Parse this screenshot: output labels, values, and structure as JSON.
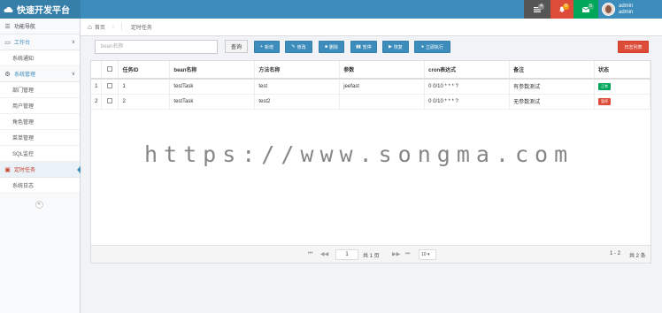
{
  "header": {
    "brand": "快速开发平台",
    "badges": [
      {
        "icon": "list-icon",
        "count": "4",
        "color": "#888888"
      },
      {
        "icon": "bell-icon",
        "count": "8",
        "color": "#f39c12"
      },
      {
        "icon": "envelope-icon",
        "count": "5",
        "color": "#00a65a"
      }
    ],
    "user": {
      "name": "admin",
      "role": "admin"
    }
  },
  "sidebar": {
    "items": [
      {
        "label": "功能导航",
        "type": "item",
        "icon": "navigation-icon"
      },
      {
        "label": "工作台",
        "type": "group",
        "icon": "monitor-icon"
      },
      {
        "label": "系统通知",
        "type": "sub"
      },
      {
        "label": "系统管理",
        "type": "group",
        "icon": "gear-icon"
      },
      {
        "label": "部门管理",
        "type": "sub"
      },
      {
        "label": "用户管理",
        "type": "sub"
      },
      {
        "label": "角色管理",
        "type": "sub"
      },
      {
        "label": "菜单管理",
        "type": "sub"
      },
      {
        "label": "SQL监控",
        "type": "sub"
      },
      {
        "label": "定时任务",
        "type": "active",
        "icon": "task-icon"
      },
      {
        "label": "系统日志",
        "type": "sub"
      }
    ]
  },
  "breadcrumb": {
    "home": "首页",
    "current": "定时任务"
  },
  "toolbar": {
    "search_placeholder": "bean名称",
    "query": "查询",
    "buttons": [
      {
        "label": "新增",
        "icon": "+"
      },
      {
        "label": "修改",
        "icon": "✎"
      },
      {
        "label": "删除",
        "icon": "■"
      },
      {
        "label": "暂停",
        "icon": "▮▮"
      },
      {
        "label": "恢复",
        "icon": "▶"
      },
      {
        "label": "立即执行",
        "icon": "●"
      }
    ],
    "log_list": "日志列表"
  },
  "table": {
    "headers": [
      "",
      "",
      "任务ID",
      "bean名称",
      "方法名称",
      "参数",
      "cron表达式",
      "备注",
      "状态"
    ],
    "rows": [
      {
        "num": "1",
        "id": "1",
        "bean": "testTask",
        "method": "test",
        "params": "jeefast",
        "cron": "0 0/10 * * * ?",
        "remark": "有参数测试",
        "status": "正常"
      },
      {
        "num": "2",
        "id": "2",
        "bean": "testTask",
        "method": "test2",
        "params": "",
        "cron": "0 0/10 * * * ?",
        "remark": "无参数测试",
        "status": "暂停"
      }
    ]
  },
  "pager": {
    "page": "1",
    "total_pages": "共 1 页",
    "page_size": "10",
    "range": "1 - 2",
    "total": "共 2 条"
  },
  "watermark": "https://www.songma.com"
}
